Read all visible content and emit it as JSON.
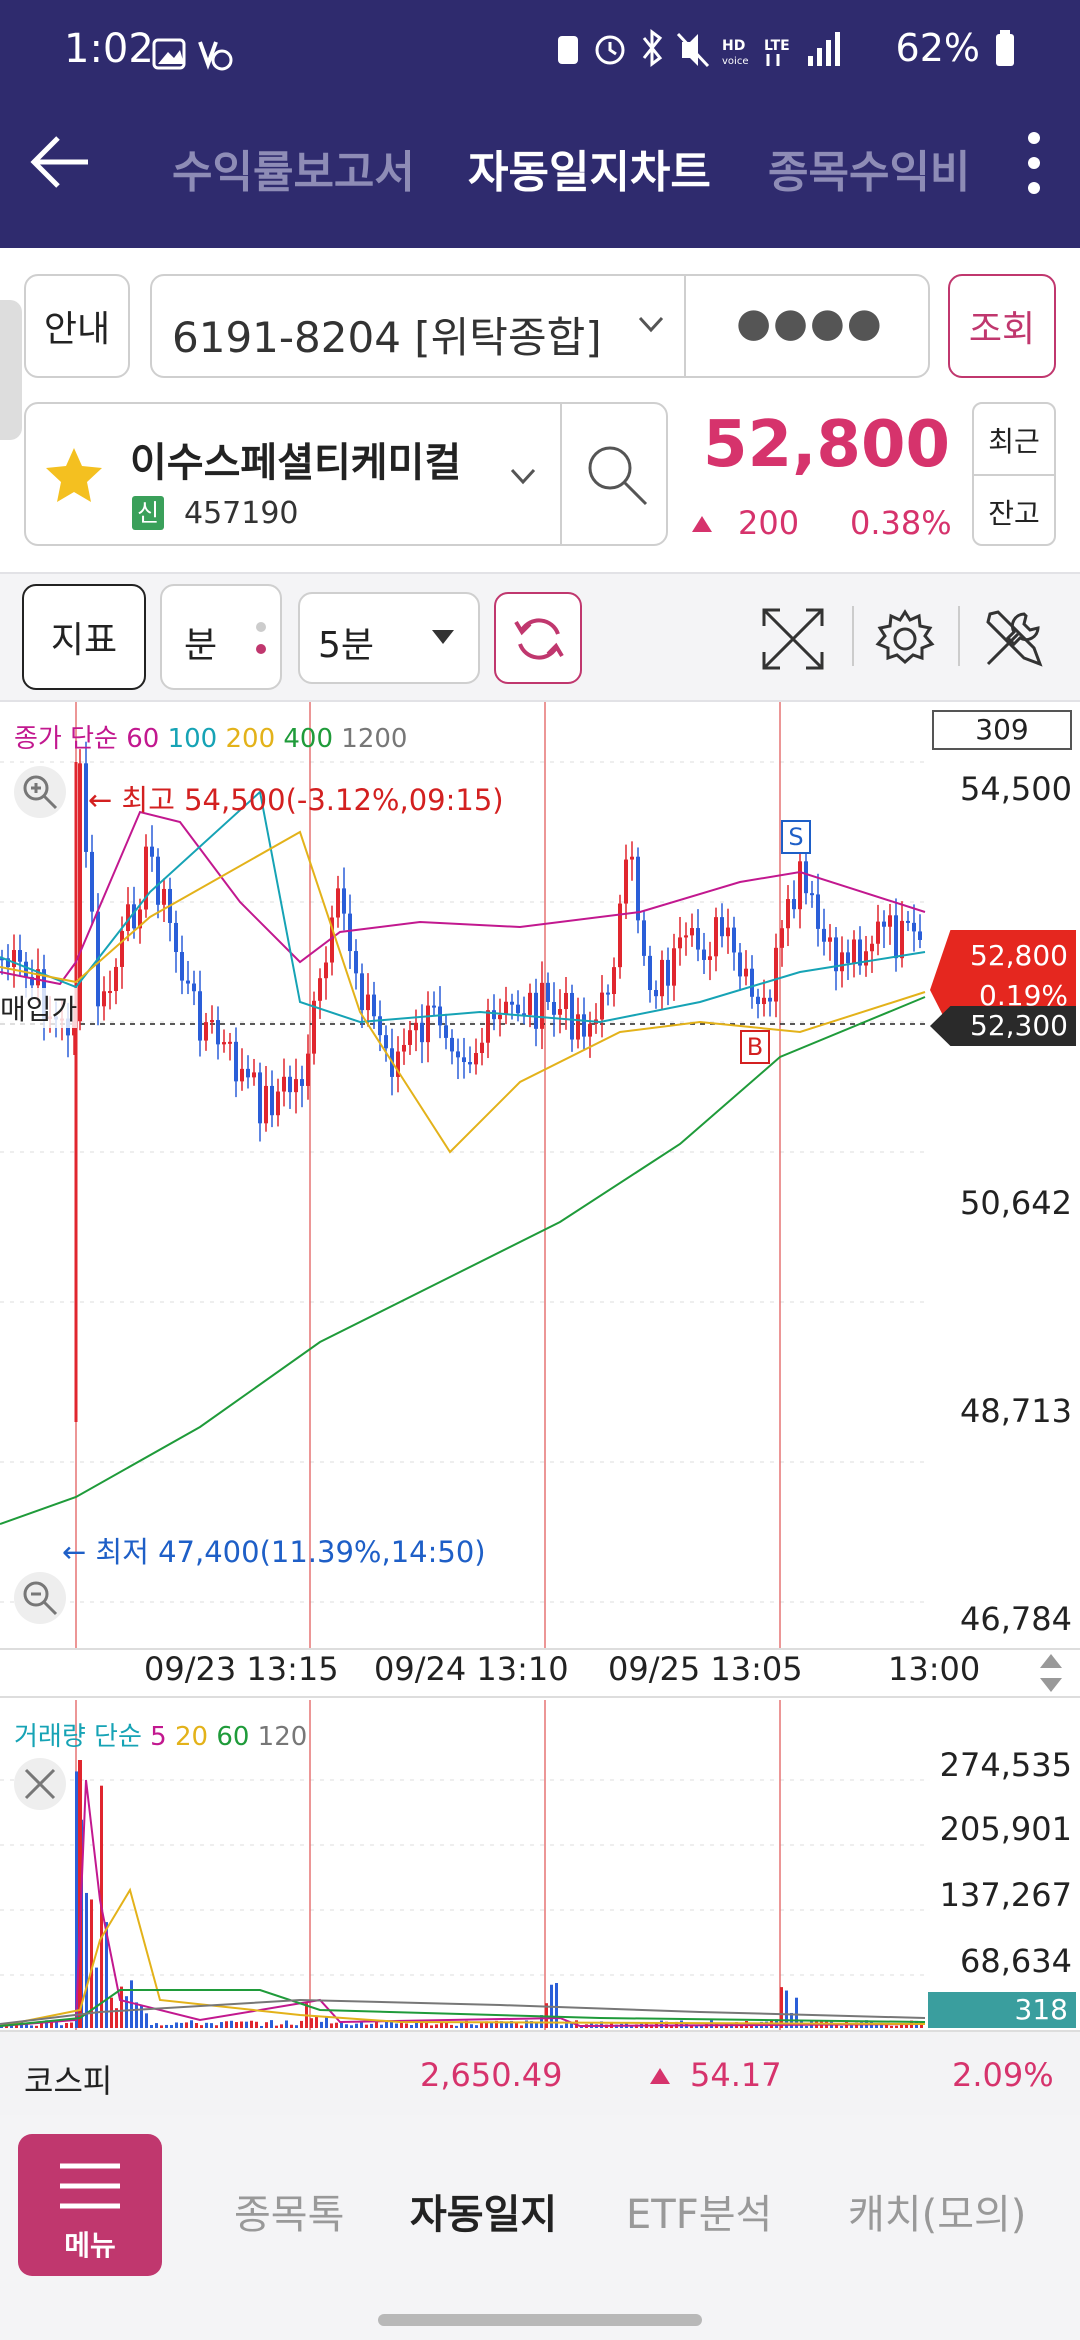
{
  "status": {
    "time": "1:02",
    "battery": "62%",
    "icons": [
      "image-icon",
      "vpn-icon",
      "charge-icon",
      "alarm-icon",
      "bluetooth-icon",
      "mute-icon",
      "hd-voice-icon",
      "lte-icon",
      "signal-icon",
      "battery-icon"
    ]
  },
  "header": {
    "tabs": [
      "수익률보고서",
      "자동일지차트",
      "종목수익비"
    ],
    "active_tab": "자동일지차트"
  },
  "account": {
    "guide_label": "안내",
    "number": "6191-8204 [위탁종합]",
    "password_mask": "●●●●",
    "lookup_label": "조회"
  },
  "stock": {
    "name": "이수스페셜티케미컬",
    "badge": "신",
    "code": "457190",
    "price": "52,800",
    "change": "200",
    "change_pct": "0.38%",
    "recent_label": "최근",
    "balance_label": "잔고"
  },
  "toolbar": {
    "indicator_label": "지표",
    "minute_label": "분",
    "interval": "5분"
  },
  "chart": {
    "legend": {
      "prefix": "종가 단순",
      "periods": [
        "60",
        "100",
        "200",
        "400",
        "1200"
      ]
    },
    "count_box": "309",
    "y_labels": [
      "54,500",
      "50,642",
      "48,713",
      "46,784"
    ],
    "high_note": "최고 54,500(-3.12%,09:15)",
    "low_note": "최저 47,400(11.39%,14:50)",
    "purchase_label": "매입가",
    "price_tag": "52,800",
    "price_tag_pct": "0.19%",
    "purchase_price_tag": "52,300",
    "x_labels": [
      "09/23 13:15",
      "09/24 13:10",
      "09/25 13:05",
      "13:00"
    ],
    "sell_marker": "S",
    "buy_marker": "B"
  },
  "volume": {
    "legend": {
      "prefix": "거래량 단순",
      "periods": [
        "5",
        "20",
        "60",
        "120"
      ]
    },
    "y_labels": [
      "274,535",
      "205,901",
      "137,267",
      "68,634"
    ],
    "current": "318"
  },
  "index": {
    "name": "코스피",
    "value": "2,650.49",
    "change": "54.17",
    "change_pct": "2.09%"
  },
  "bottom_nav": {
    "menu_label": "메뉴",
    "items": [
      "종목톡",
      "자동일지",
      "ETF분석",
      "캐치(모의)"
    ],
    "active": "자동일지"
  },
  "colors": {
    "header_bg": "#2f2b6e",
    "up": "#d6336c",
    "down": "#1e5fc7",
    "ma60": "#c2188f",
    "ma100": "#16a3b5",
    "ma200": "#e3b21a",
    "ma400": "#1f9b3a",
    "ma1200": "#999999",
    "menu_bg": "#c0376e"
  }
}
